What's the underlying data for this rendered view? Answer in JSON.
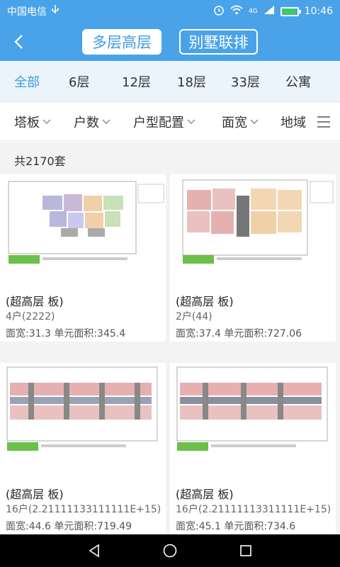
{
  "status": {
    "carrier": "中国电信",
    "time": "10:46",
    "network": "4G",
    "battery_level": 0.85
  },
  "header": {
    "tabs": [
      {
        "label": "多层高层",
        "active": true
      },
      {
        "label": "别墅联排",
        "active": false
      }
    ]
  },
  "floors": {
    "items": [
      "全部",
      "6层",
      "12层",
      "18层",
      "33层",
      "公寓"
    ],
    "active_index": 0
  },
  "filters": {
    "items": [
      "塔板",
      "户数",
      "户型配置",
      "面宽",
      "地域"
    ]
  },
  "list": {
    "count_text": "共2170套",
    "cards": [
      {
        "title": "(超高层  板)",
        "units": "4户(2222)",
        "specs": "面宽:31.3 单元面积:345.4"
      },
      {
        "title": "(超高层  板)",
        "units": "2户(44)",
        "specs": "面宽:37.4 单元面积:727.06"
      },
      {
        "title": "(超高层  板)",
        "units": "16户(2.21111133111111E+15)",
        "specs": "面宽:44.6 单元面积:719.49"
      },
      {
        "title": "(超高层  板)",
        "units": "16户(2.21111113311111E+15)",
        "specs": "面宽:45.1 单元面积:734.6"
      }
    ]
  },
  "colors": {
    "accent": "#4aa3e8",
    "accent_text": "#3c9be3"
  }
}
